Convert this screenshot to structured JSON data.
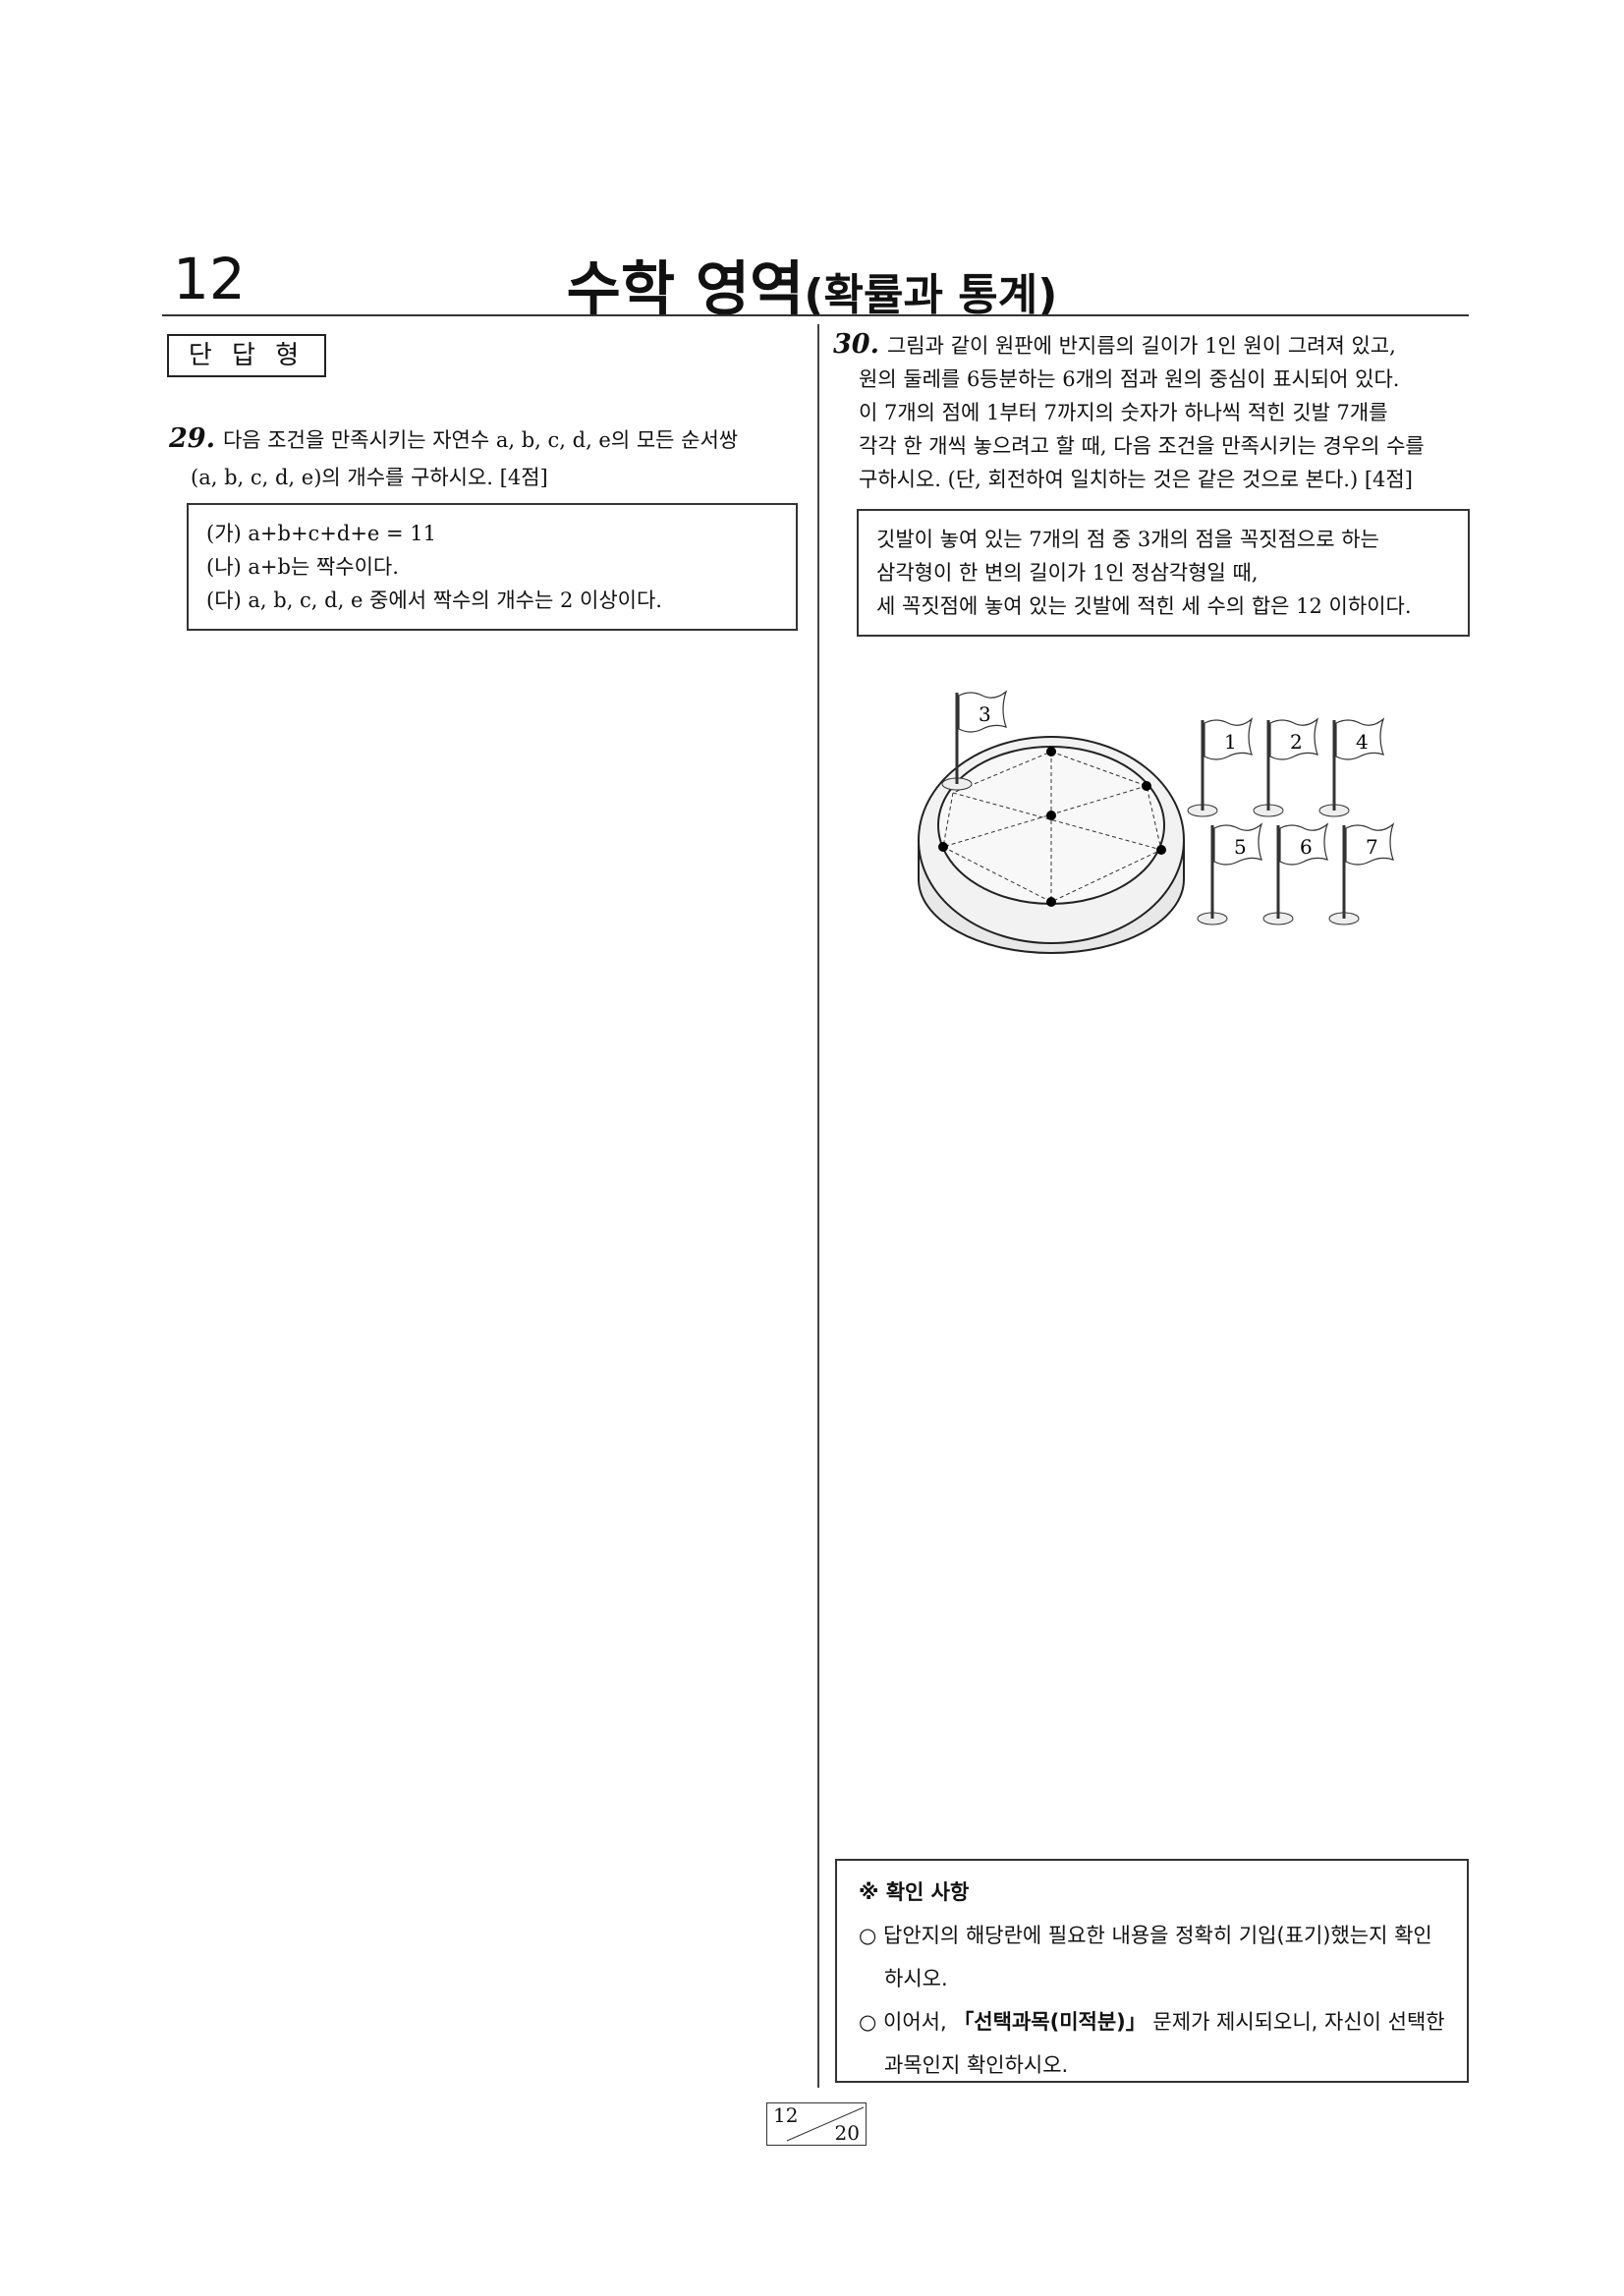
{
  "header": {
    "page_number": "12",
    "title": "수학 영역",
    "subtitle": "(확률과 통계)"
  },
  "section_label": "단 답 형",
  "q29": {
    "number": "29.",
    "lines": [
      "다음 조건을 만족시키는 자연수 a, b, c, d, e의 모든 순서쌍",
      "(a, b, c, d, e)의 개수를 구하시오. [4점]"
    ],
    "conditions": [
      "(가) a+b+c+d+e = 11",
      "(나) a+b는 짝수이다.",
      "(다) a, b, c, d, e 중에서 짝수의 개수는 2 이상이다."
    ]
  },
  "q30": {
    "number": "30.",
    "lines": [
      "그림과 같이 원판에 반지름의 길이가 1인 원이 그려져 있고,",
      "원의 둘레를 6등분하는 6개의 점과 원의 중심이 표시되어 있다.",
      "이 7개의 점에 1부터 7까지의 숫자가 하나씩 적힌 깃발 7개를",
      "각각 한 개씩 놓으려고 할 때, 다음 조건을 만족시키는 경우의 수를",
      "구하시오. (단, 회전하여 일치하는 것은 같은 것으로 본다.) [4점]"
    ],
    "conditions": [
      "깃발이 놓여 있는 7개의 점 중 3개의 점을 꼭짓점으로 하는",
      "삼각형이 한 변의 길이가 1인 정삼각형일 때,",
      "세 꼭짓점에 놓여 있는 깃발에 적힌 세 수의 합은 12 이하이다."
    ],
    "flags": [
      "3",
      "1",
      "2",
      "4",
      "5",
      "6",
      "7"
    ]
  },
  "notice": {
    "head": "※ 확인 사항",
    "item1": "○ 답안지의 해당란에 필요한 내용을 정확히 기입(표기)했는지 확인하시오.",
    "item2_pre": "○ 이어서, ",
    "item2_bold": "「선택과목(미적분)」",
    "item2_post": " 문제가 제시되오니, 자신이 선택한 과목인지 확인하시오."
  },
  "footer": {
    "current": "12",
    "total": "20"
  }
}
